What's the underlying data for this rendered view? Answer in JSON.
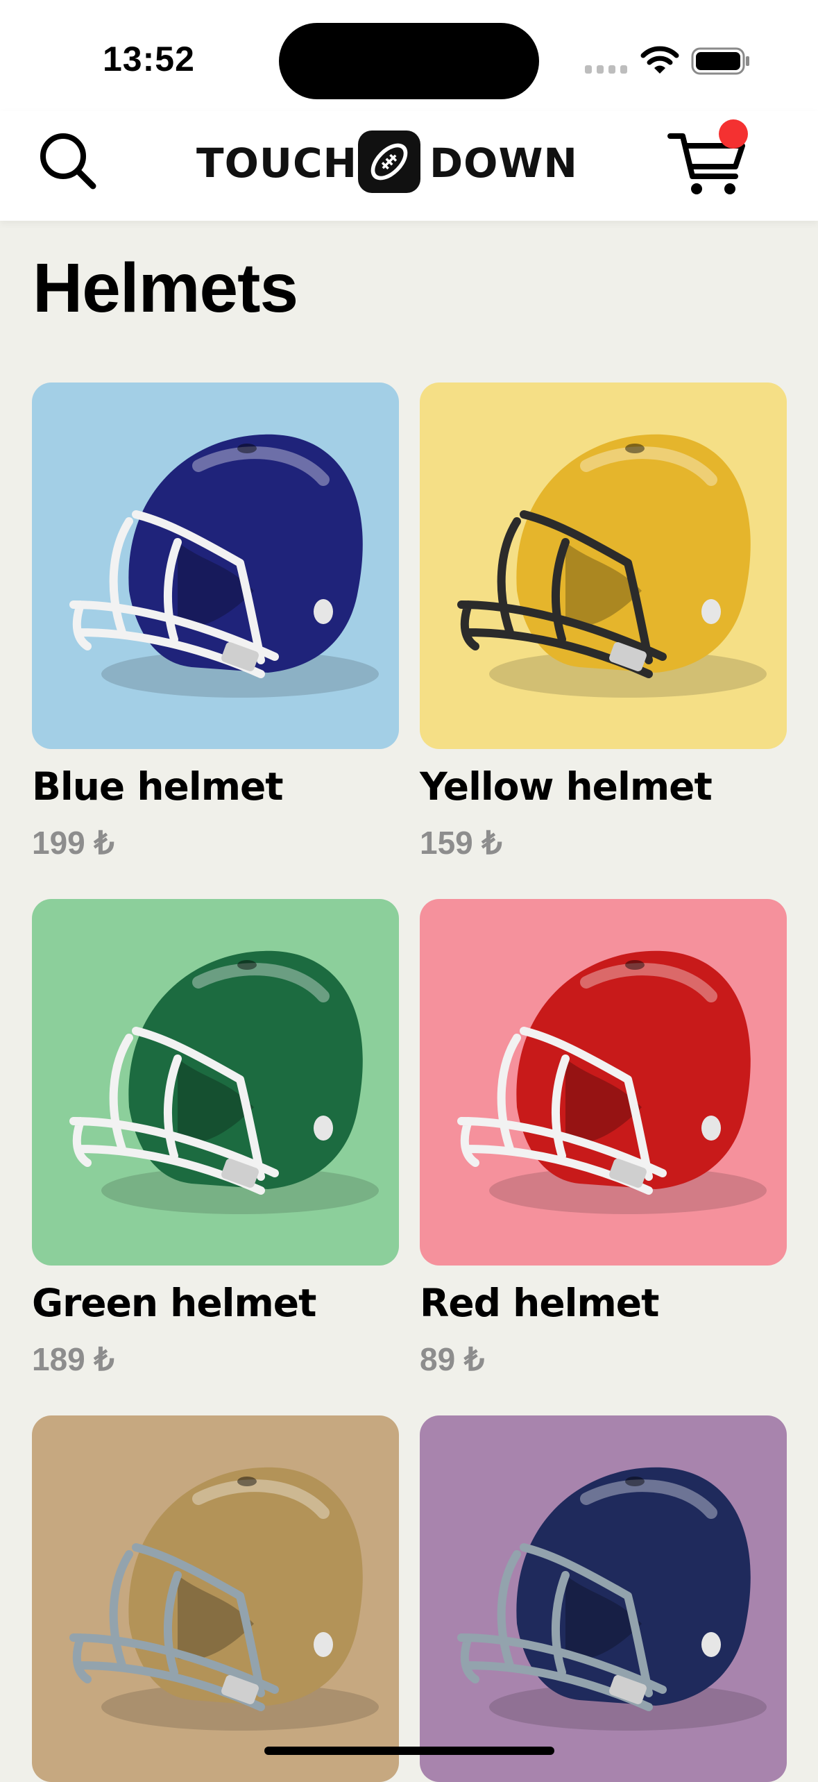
{
  "status_bar": {
    "time": "13:52"
  },
  "header": {
    "logo_left": "TOUCH",
    "logo_right": "DOWN",
    "search_icon": "search-icon",
    "cart_icon": "cart-icon",
    "cart_badge_color": "#f43131"
  },
  "page": {
    "title": "Helmets"
  },
  "products": [
    {
      "name": "Blue helmet",
      "price": "199 ₺",
      "bg": "#a3cfe6",
      "shell": "#1f237a",
      "mask": "#f2f2f2"
    },
    {
      "name": "Yellow helmet",
      "price": "159 ₺",
      "bg": "#f5df86",
      "shell": "#e5b52c",
      "mask": "#2b2b2b"
    },
    {
      "name": "Green helmet",
      "price": "189 ₺",
      "bg": "#8ccf9b",
      "shell": "#1c6b40",
      "mask": "#f2f2f2"
    },
    {
      "name": "Red helmet",
      "price": "89 ₺",
      "bg": "#f5919c",
      "shell": "#c81a1a",
      "mask": "#f2f2f2"
    },
    {
      "bg": "#c6a880",
      "shell": "#b39358",
      "mask": "#93a3ad"
    },
    {
      "bg": "#a884ad",
      "shell": "#1f2a5c",
      "mask": "#93a3ad"
    }
  ]
}
